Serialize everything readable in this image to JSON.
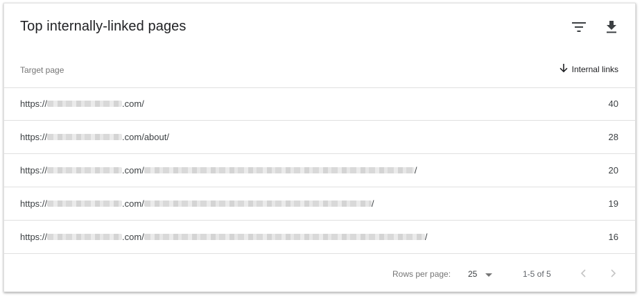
{
  "card": {
    "title": "Top internally-linked pages",
    "toolbar": {
      "filter_icon": "filter-icon",
      "download_icon": "download-icon"
    }
  },
  "table": {
    "columns": {
      "target_page": "Target page",
      "internal_links": "Internal links"
    },
    "sort": {
      "column": "internal_links",
      "direction": "descending",
      "icon": "arrow-down-icon"
    },
    "rows": [
      {
        "prefix": "https://",
        "middle": ".com/",
        "suffix": "",
        "value": "40"
      },
      {
        "prefix": "https://",
        "middle": ".com/about/",
        "suffix": "",
        "value": "28"
      },
      {
        "prefix": "https://",
        "middle": ".com/",
        "suffix": "/",
        "value": "20"
      },
      {
        "prefix": "https://",
        "middle": ".com/",
        "suffix": "/",
        "value": "19"
      },
      {
        "prefix": "https://",
        "middle": ".com/",
        "suffix": "/",
        "value": "16"
      }
    ]
  },
  "pagination": {
    "rows_per_page_label": "Rows per page:",
    "rows_per_page_value": "25",
    "range_text": "1-5 of 5"
  },
  "colors": {
    "text_primary": "#202124",
    "text_secondary": "#757575",
    "divider": "#e0e0e0",
    "icon": "#5f6368"
  }
}
